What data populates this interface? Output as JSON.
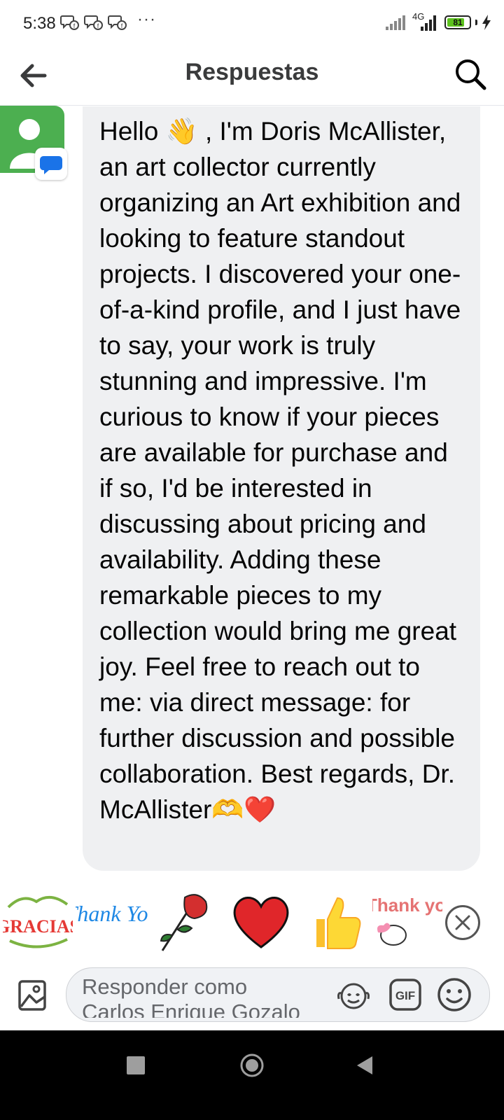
{
  "status_bar": {
    "time": "5:38",
    "more": "···",
    "network": "4G",
    "battery_percent": 81,
    "battery_label": "81"
  },
  "header": {
    "title": "Respuestas",
    "back_icon": "arrow-left-icon",
    "search_icon": "search-icon"
  },
  "message": {
    "text": "Hello 👋 , I'm Doris McAllister, an art collector currently organizing an Art exhibition and looking to feature standout projects. I discovered your one-of-a-kind profile, and I just have to say, your work is truly stunning and impressive. I'm curious to know if your pieces are available for purchase and if so, I'd be interested in discussing about pricing and availability. Adding these remarkable pieces to my collection would bring me great joy. Feel free to reach out to me: via direct message: for further discussion and possible collaboration. Best regards, Dr. McAllister🫶❤️"
  },
  "stickers": [
    {
      "name": "gracias",
      "text": "GRACIAS"
    },
    {
      "name": "thank-you-script",
      "text": "Thank You"
    },
    {
      "name": "rose",
      "text": ""
    },
    {
      "name": "heart",
      "text": ""
    },
    {
      "name": "thumbs-up",
      "text": ""
    },
    {
      "name": "thank-you-bunny",
      "text": "Thank you"
    }
  ],
  "composer": {
    "placeholder": "Responder como Carlos Enrique Gozalo Ara",
    "gif_label": "GIF"
  },
  "colors": {
    "accent": "#1877f2",
    "bubble": "#eff0f2",
    "avatar": "#4caf50",
    "battery": "#5dc21e"
  }
}
